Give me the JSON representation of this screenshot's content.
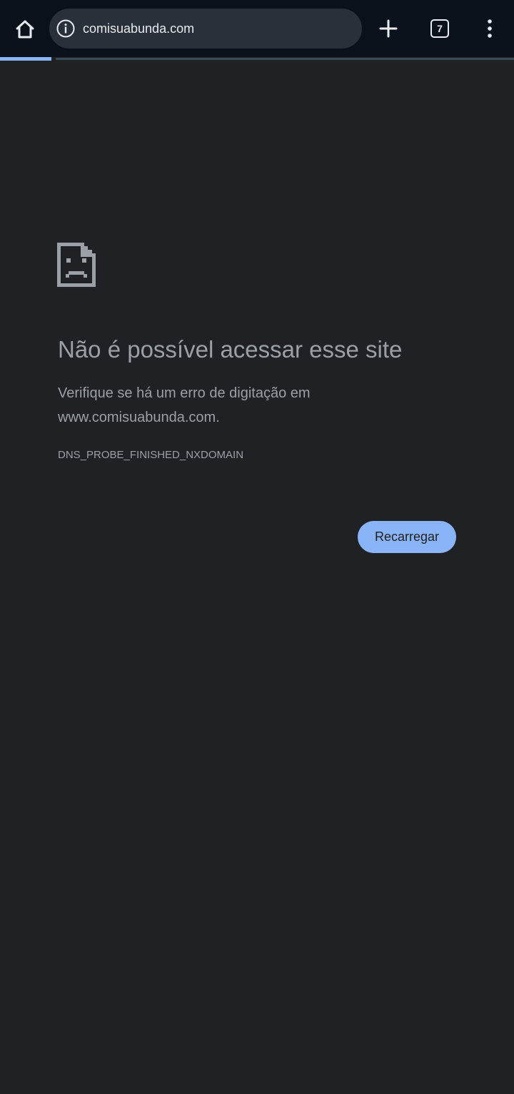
{
  "browser": {
    "url": "comisuabunda.com",
    "tab_count": "7",
    "load_progress_fraction": 0.1,
    "icons": {
      "home": "home-icon",
      "site_info": "info-icon",
      "new_tab": "plus-icon",
      "tabs": "tab-switcher-icon",
      "menu": "more-vert-icon"
    },
    "colors": {
      "toolbar_bg": "#0b111a",
      "omnibox_bg": "#2a3039",
      "progress": "#8ab4f8"
    }
  },
  "error_page": {
    "icon": "sad-file-icon",
    "title": "Não é possível acessar esse site",
    "description": "Verifique se há um erro de digitação em www.comisuabunda.com.",
    "error_code": "DNS_PROBE_FINISHED_NXDOMAIN",
    "reload_label": "Recarregar",
    "colors": {
      "background": "#202124",
      "text": "#9aa0a6",
      "button": "#8ab4f8"
    }
  }
}
